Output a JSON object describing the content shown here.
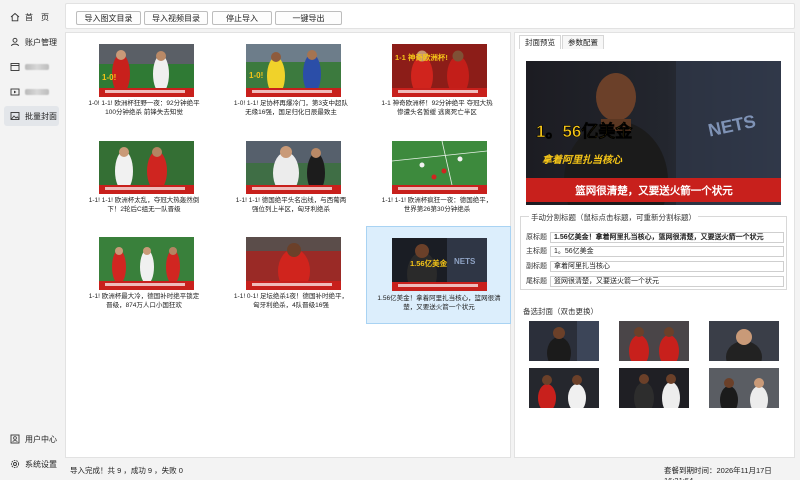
{
  "sidebar": {
    "items": [
      {
        "label": "首　页",
        "icon": "home-icon"
      },
      {
        "label": "账户管理",
        "icon": "user-icon"
      },
      {
        "label": "",
        "icon": "window-icon"
      },
      {
        "label": "",
        "icon": "video-icon"
      },
      {
        "label": "批量封面",
        "icon": "image-icon"
      }
    ],
    "bottom": [
      {
        "label": "用户中心",
        "icon": "user-center-icon"
      },
      {
        "label": "系统设置",
        "icon": "gear-icon"
      }
    ]
  },
  "toolbar": {
    "import_images": "导入图文目录",
    "import_videos": "导入视频目录",
    "stop_import": "停止导入",
    "export_all": "一键导出"
  },
  "grid": {
    "items": [
      {
        "caption": "1-0!  1-1!  欧洲杯狂野一夜：92分钟绝平 100分钟绝杀 前锋失去知觉",
        "overlay": "1-0!"
      },
      {
        "caption": "1-0!  1-1!  足协杯再爆冷门，第3支中超队无缘16强，国足归化日辰最致主",
        "overlay": "1-0!"
      },
      {
        "caption": "1-1  神奇欧洲杯！92分钟绝平  夺冠大热惨遭头名暂缓 逃离死亡半区",
        "overlay": "1-1 神奇欧洲杯!"
      },
      {
        "caption": "1-1!  1-1!  欧洲杯太乱，夺冠大热轰然倒下！2轮后C组无一队晋级",
        "overlay": ""
      },
      {
        "caption": "1-1!  1-1!  德国绝平头名出线，与西葡两强位列上半区，匈牙利绝杀",
        "overlay": ""
      },
      {
        "caption": "1-1!  1-1!  欧洲杯疯狂一夜：德国绝平，世界第26第30分钟绝杀",
        "overlay": ""
      },
      {
        "caption": "1-1!  欧洲杯最大冷，德国补时绝平锁定晋级，874万人口小国狂欢",
        "overlay": ""
      },
      {
        "caption": "1-1!  0-1!  足坛绝杀1夜！德国补时绝平，匈牙利绝杀，4队晋级16强",
        "overlay": ""
      },
      {
        "caption": "1.56亿美金！拿着阿里扎当核心，篮网很清楚，又要送火箭一个状元",
        "overlay": "1.56亿美金"
      }
    ]
  },
  "right": {
    "tabs": [
      "封面预览",
      "参数配置"
    ],
    "preview": {
      "big_text": "1。56亿美金",
      "sub_text": "拿着阿里扎当核心",
      "banner": "篮网很清楚，又要送火箭一个状元",
      "jersey": "NETS"
    },
    "split_group_title": "手动分割标题（鼠标点击标题，可重新分割标题）",
    "fields": [
      {
        "label": "原标题",
        "value": "1.56亿美金！拿着阿里扎当核心，篮网很清楚，又要送火箭一个状元"
      },
      {
        "label": "主标题",
        "value": "1。56亿美金"
      },
      {
        "label": "副标题",
        "value": "拿着阿里扎当核心"
      },
      {
        "label": "尾标题",
        "value": "篮网很清楚，又要送火箭一个状元"
      }
    ],
    "backup_title": "备选封面（双击更换）"
  },
  "status": {
    "left": "导入完成！共 9 ，成功 9 ，失败 0",
    "right": "套餐到期时间：2026年11月17日 16:21:54"
  },
  "colors": {
    "accent_red": "#d9241c",
    "highlight_yellow": "#f5c518",
    "selected_bg": "#dceefc"
  }
}
